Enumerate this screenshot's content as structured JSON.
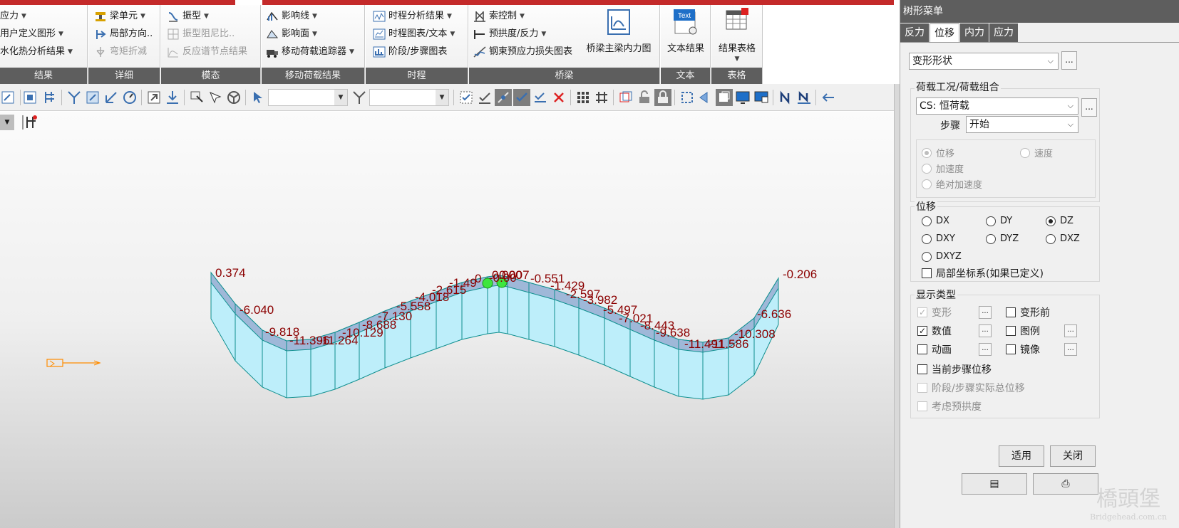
{
  "ribbon": {
    "groups": [
      {
        "title": "结果",
        "items": [
          "应力",
          "用户定义图形",
          "水化热分析结果"
        ]
      },
      {
        "title": "详细",
        "items": [
          "梁单元",
          "局部方向..",
          "弯矩折减"
        ]
      },
      {
        "title": "模态",
        "items": [
          "振型",
          "振型阻尼比..",
          "反应谱节点结果"
        ]
      },
      {
        "title": "移动荷载结果",
        "items": [
          "影响线",
          "影响面",
          "移动荷载追踪器"
        ]
      },
      {
        "title": "时程",
        "items": [
          "时程分析结果",
          "时程图表/文本",
          "阶段/步骤图表"
        ]
      },
      {
        "title": "桥梁",
        "items": [
          "索控制",
          "预拱度/反力",
          "钢束预应力损失图表"
        ],
        "big_label": "桥梁主梁内力图"
      },
      {
        "title": "文本",
        "big_label": "文本结果",
        "icon_text": "Text"
      },
      {
        "title": "表格",
        "big_label": "结果表格"
      }
    ]
  },
  "toolbar": {
    "select1_value": "",
    "select2_value": ""
  },
  "model_view": {
    "labels": [
      "0.374",
      "-6.040",
      "-9.818",
      "-11.396",
      "-11.264",
      "-10.129",
      "-8.688",
      "-7.130",
      "-5.558",
      "-4.018",
      "-2.615",
      "-1.49",
      "0",
      "-0.00",
      "0.000",
      "0.007",
      "-0.551",
      "-1.429",
      "-2.597",
      "-3.982",
      "-5.497",
      "-7.021",
      "-8.443",
      "-9.638",
      "-11.491",
      "-11.586",
      "-10.308",
      "-6.636",
      "-0.206"
    ],
    "label_color": "#8b0000"
  },
  "panel": {
    "title": "树形菜单",
    "tabs": [
      "反力",
      "位移",
      "内力",
      "应力"
    ],
    "active_tab": "位移",
    "mode_select": "变形形状",
    "loadcase_group_label": "荷载工况/荷载组合",
    "loadcase_value": "CS: 恒荷载",
    "step_label": "步骤",
    "step_value": "开始",
    "motion_options": [
      "位移",
      "速度",
      "加速度",
      "绝对加速度"
    ],
    "motion_selected": "位移",
    "disp_group_label": "位移",
    "disp_options": [
      "DX",
      "DY",
      "DZ",
      "DXY",
      "DYZ",
      "DXZ",
      "DXYZ"
    ],
    "disp_selected": "DZ",
    "local_coord_label": "局部坐标系(如果已定义)",
    "display_group_label": "显示类型",
    "display_options": {
      "deform": "变形",
      "before_deform": "变形前",
      "values": "数值",
      "legend": "图例",
      "animation": "动画",
      "mirror": "镜像",
      "current_step": "当前步骤位移",
      "stage_total": "阶段/步骤实际总位移",
      "camber": "考虑预拱度"
    },
    "apply_label": "适用",
    "close_label": "关闭",
    "ellipsis": "..."
  },
  "watermark": {
    "line1": "橋頭堡",
    "line2": "Bridgehead.com.cn"
  },
  "colors": {
    "accent": "#c42a2a",
    "group_bar": "#5e5e5e",
    "beam_fill": "#bdeefa",
    "beam_line": "#0f8f8f"
  }
}
